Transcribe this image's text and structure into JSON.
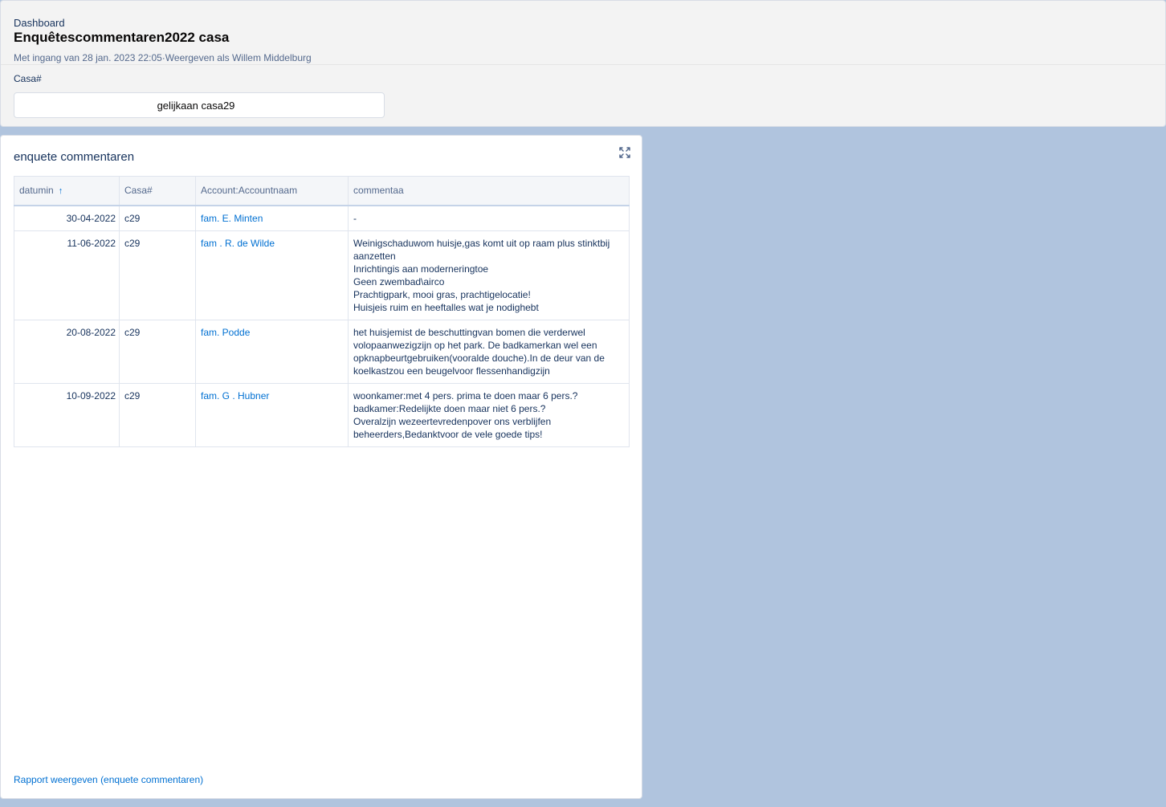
{
  "header": {
    "eyebrow": "Dashboard",
    "title": "Enquêtescommentaren2022 casa",
    "subtitle": "Met ingang van 28 jan. 2023 22:05·Weergeven als Willem Middelburg"
  },
  "filter": {
    "label": "Casa#",
    "value": "gelijkaan casa29"
  },
  "card": {
    "title": "enquete commentaren",
    "expand_icon": "expand-icon",
    "report_link": "Rapport weergeven (enquete commentaren)"
  },
  "table": {
    "columns": [
      "datumin",
      "Casa#",
      "Account:Accountnaam",
      "commentaa"
    ],
    "sort_icon": "arrow-up-icon",
    "rows": [
      {
        "date": "30-04-2022",
        "casa": "c29",
        "account": "fam. E. Minten",
        "comment": [
          "-"
        ]
      },
      {
        "date": "11-06-2022",
        "casa": "c29",
        "account": "fam . R. de Wilde",
        "comment": [
          "Weinigschaduwom huisje,gas komt uit op raam plus stinktbij aanzetten",
          "Inrichtingis aan moderneringtoe",
          "Geen zwembad\\airco",
          "Prachtigpark, mooi gras, prachtigelocatie!",
          "Huisjeis ruim en heeftalles wat je nodighebt"
        ]
      },
      {
        "date": "20-08-2022",
        "casa": "c29",
        "account": "fam. Podde",
        "comment": [
          "het huisjemist de beschuttingvan bomen die verderwel volopaanwezigzijn op het park. De badkamerkan wel een opknapbeurtgebruiken(vooralde douche).In de deur van de koelkastzou een beugelvoor flessenhandigzijn"
        ]
      },
      {
        "date": "10-09-2022",
        "casa": "c29",
        "account": "fam. G . Hubner",
        "comment": [
          "woonkamer:met 4 pers. prima te doen maar 6 pers.?",
          "badkamer:Redelijkte doen maar niet 6 pers.?",
          "Overalzijn wezeertevredenpover ons verblijfen beheerders,Bedanktvoor de vele goede tips!"
        ]
      }
    ]
  }
}
